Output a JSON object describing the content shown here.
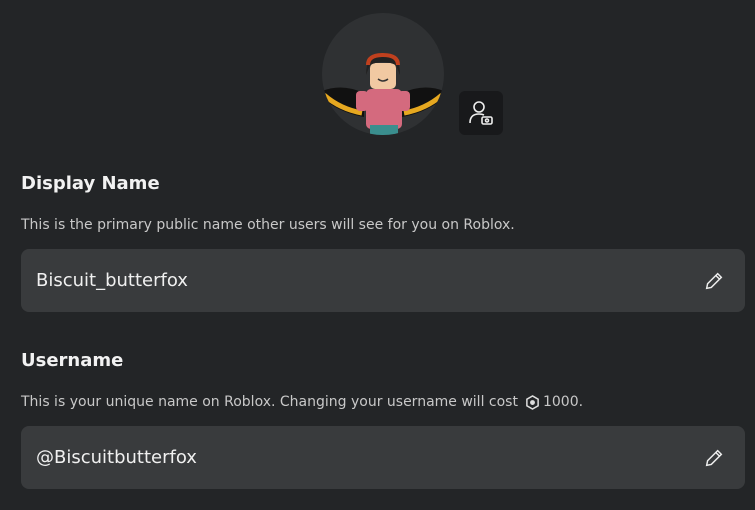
{
  "display_name": {
    "heading": "Display Name",
    "description": "This is the primary public name other users will see for you on Roblox.",
    "value": "Biscuit_butterfox"
  },
  "username": {
    "heading": "Username",
    "description_prefix": "This is your unique name on Roblox. Changing your username will cost",
    "cost": "1000.",
    "value": "@Biscuitbutterfox"
  }
}
